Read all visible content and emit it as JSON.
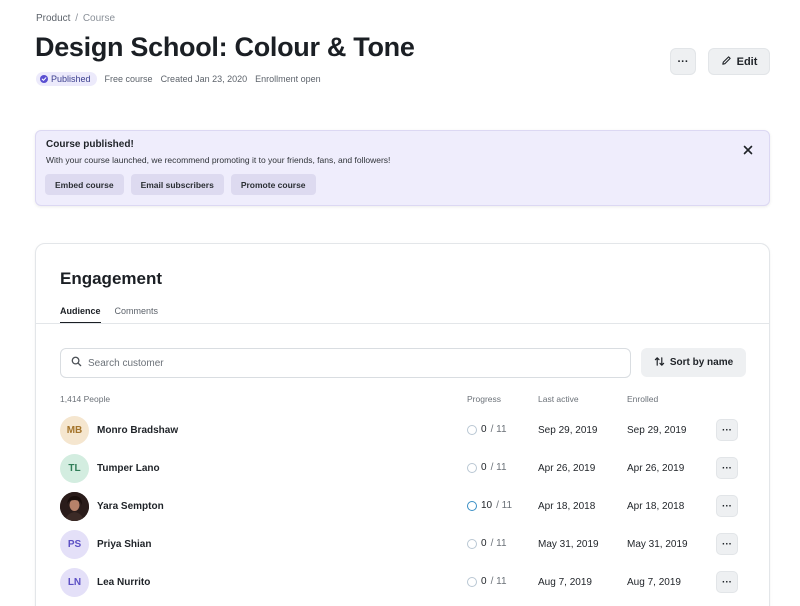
{
  "breadcrumb": {
    "parent": "Product",
    "separator": "/",
    "current": "Course"
  },
  "page": {
    "title": "Design School: Colour & Tone",
    "status": "Published",
    "meta": [
      "Free course",
      "Created Jan 23, 2020",
      "Enrollment open"
    ]
  },
  "header_actions": {
    "more_label": "···",
    "edit_label": "Edit"
  },
  "banner": {
    "title": "Course published!",
    "text": "With your course launched, we recommend promoting it to your friends, fans, and followers!",
    "buttons": [
      "Embed course",
      "Email subscribers",
      "Promote course"
    ]
  },
  "engagement": {
    "title": "Engagement",
    "tabs": [
      "Audience",
      "Comments"
    ],
    "search_placeholder": "Search customer",
    "sort_label": "Sort by name",
    "count_label": "1,414 People",
    "columns": {
      "progress": "Progress",
      "last_active": "Last active",
      "enrolled": "Enrolled"
    },
    "rows": [
      {
        "initials": "MB",
        "name": "Monro Bradshaw",
        "progress": "0",
        "total": "/ 11",
        "last_active": "Sep 29, 2019",
        "enrolled": "Sep 29, 2019",
        "avatar_bg": "#f5e6cf",
        "avatar_fg": "#a4742a"
      },
      {
        "initials": "TL",
        "name": "Tumper Lano",
        "progress": "0",
        "total": "/ 11",
        "last_active": "Apr 26, 2019",
        "enrolled": "Apr 26, 2019",
        "avatar_bg": "#d3ede0",
        "avatar_fg": "#2f7d57"
      },
      {
        "initials": "",
        "name": "Yara Sempton",
        "progress": "10",
        "total": "/ 11",
        "last_active": "Apr 18, 2018",
        "enrolled": "Apr 18, 2018",
        "avatar_bg": "#2a1c1a",
        "avatar_fg": "#ffffff"
      },
      {
        "initials": "PS",
        "name": "Priya Shian",
        "progress": "0",
        "total": "/ 11",
        "last_active": "May 31, 2019",
        "enrolled": "May 31, 2019",
        "avatar_bg": "#e4e0f8",
        "avatar_fg": "#5b4fc4"
      },
      {
        "initials": "LN",
        "name": "Lea Nurrito",
        "progress": "0",
        "total": "/ 11",
        "last_active": "Aug 7, 2019",
        "enrolled": "Aug 7, 2019",
        "avatar_bg": "#e4e0f8",
        "avatar_fg": "#5b4fc4"
      }
    ],
    "row_more_label": "···"
  },
  "colors": {
    "accent": "#5a4fd1",
    "banner_bg": "#efedfc",
    "progress_ring": "#3a8fc5"
  }
}
